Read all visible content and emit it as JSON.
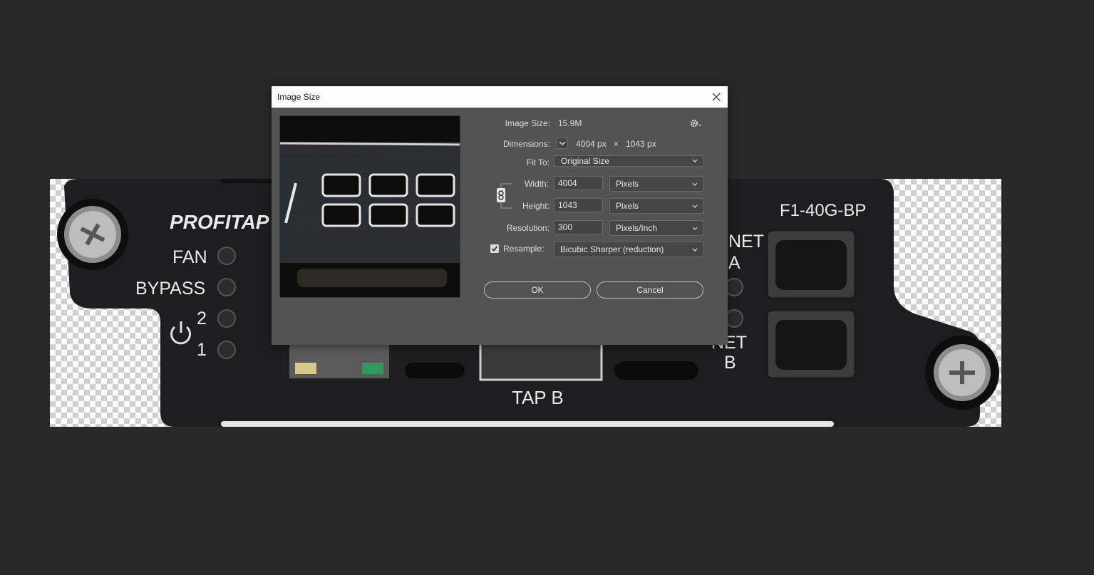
{
  "canvas": {
    "photo_labels": {
      "brand": "PROFITAP",
      "fan": "FAN",
      "bypass": "BYPASS",
      "led_2": "2",
      "led_1": "1",
      "model": "F1-40G-BP",
      "net_a_top": "NET",
      "net_a_bottom": "A",
      "net_b_top": "NET",
      "net_b_bottom": "B",
      "tap_b": "TAP B"
    }
  },
  "dialog": {
    "title": "Image Size",
    "image_size_label": "Image Size:",
    "image_size_value": "15.9M",
    "dimensions_label": "Dimensions:",
    "dimensions_width": "4004 px",
    "dimensions_x": "×",
    "dimensions_height": "1043 px",
    "fit_to_label": "Fit To:",
    "fit_to_value": "Original Size",
    "width_label": "Width:",
    "width_value": "4004",
    "width_unit": "Pixels",
    "height_label": "Height:",
    "height_value": "1043",
    "height_unit": "Pixels",
    "resolution_label": "Resolution:",
    "resolution_value": "300",
    "resolution_unit": "Pixels/Inch",
    "resample_label": "Resample:",
    "resample_checked": true,
    "resample_value": "Bicubic Sharper (reduction)",
    "ok_label": "OK",
    "cancel_label": "Cancel",
    "icons": [
      "close-icon",
      "gear-icon",
      "chevron-down-icon",
      "link-icon",
      "checkmark-icon"
    ]
  }
}
